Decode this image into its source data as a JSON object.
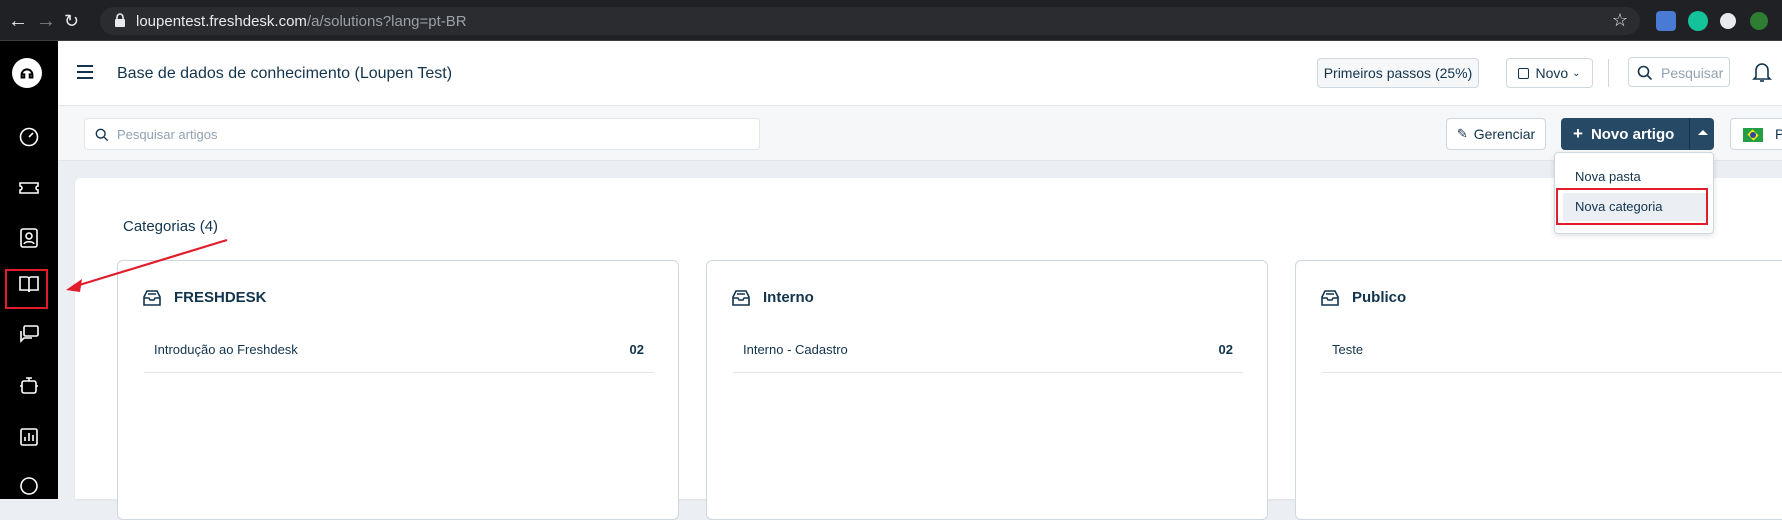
{
  "browser": {
    "url_host": "loupentest.freshdesk.com",
    "url_path": "/a/solutions?lang=pt-BR"
  },
  "header": {
    "title": "Base de dados de conhecimento (Loupen Test)",
    "getting_started": "Primeiros passos (25%)",
    "new_label": "Novo",
    "search_placeholder": "Pesquisar"
  },
  "subbar": {
    "search_placeholder": "Pesquisar artigos",
    "manage_label": "Gerenciar",
    "new_article_label": "Novo artigo",
    "language_initial": "P"
  },
  "dropdown": {
    "items": [
      {
        "label": "Nova pasta"
      },
      {
        "label": "Nova categoria"
      }
    ]
  },
  "content": {
    "categories_title": "Categorias (4)",
    "cards": [
      {
        "title": "FRESHDESK",
        "row_label": "Introdução ao Freshdesk",
        "row_count": "02"
      },
      {
        "title": "Interno",
        "row_label": "Interno - Cadastro",
        "row_count": "02"
      },
      {
        "title": "Publico",
        "row_label": "Teste",
        "row_count": ""
      }
    ]
  },
  "colors": {
    "accent": "#264966",
    "highlight": "#e11d2b",
    "sidebar": "#000000"
  }
}
